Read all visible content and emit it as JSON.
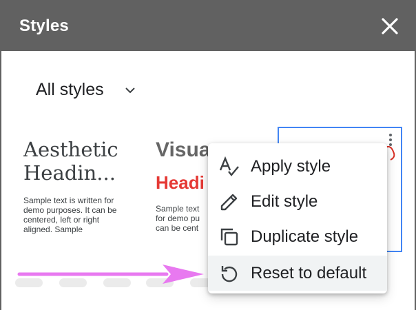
{
  "dialog": {
    "title": "Styles"
  },
  "filter": {
    "selected": "All styles"
  },
  "cards": [
    {
      "heading": "Aesthetic Headin...",
      "sample": "Sample text is written for demo purposes. It can be centered, left or right aligned. Sample"
    },
    {
      "heading": "Visua",
      "subheading": "Headi",
      "sample_lines": [
        "Sample text",
        "for demo pu",
        "can be cent"
      ]
    }
  ],
  "menu": {
    "items": [
      {
        "label": "Apply style",
        "icon": "text-check-icon"
      },
      {
        "label": "Edit style",
        "icon": "pencil-icon"
      },
      {
        "label": "Duplicate style",
        "icon": "copy-icon"
      },
      {
        "label": "Reset to default",
        "icon": "reset-icon"
      }
    ]
  },
  "colors": {
    "titlebar": "#616161",
    "selected_border": "#4285f4",
    "accent_red": "#e53935",
    "annotation_arrow": "#e879f0"
  }
}
